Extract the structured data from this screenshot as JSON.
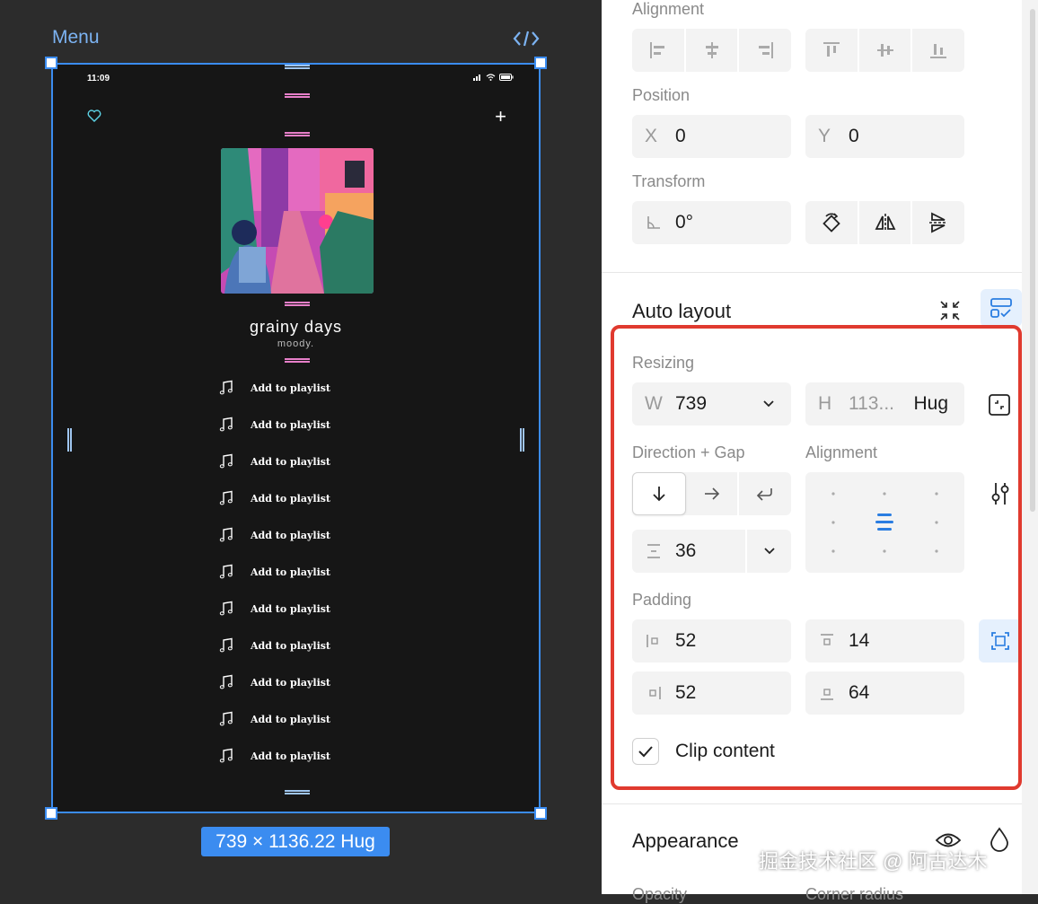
{
  "canvas": {
    "frame_label": "Menu",
    "status_time": "11:09",
    "album": {
      "title": "grainy days",
      "subtitle": "moody."
    },
    "playlist_items": [
      "Add to playlist",
      "Add to playlist",
      "Add to playlist",
      "Add to playlist",
      "Add to playlist",
      "Add to playlist",
      "Add to playlist",
      "Add to playlist",
      "Add to playlist",
      "Add to playlist",
      "Add to playlist"
    ],
    "dimension_badge": "739 × 1136.22 Hug",
    "icons": [
      "code-icon",
      "heart-icon",
      "plus-icon",
      "music-note-icon",
      "signal-icon",
      "wifi-icon",
      "battery-icon"
    ]
  },
  "panel": {
    "alignment_top_label": "Alignment",
    "position_label": "Position",
    "position_x_prefix": "X",
    "position_x": "0",
    "position_y_prefix": "Y",
    "position_y": "0",
    "transform_label": "Transform",
    "rotation": "0°",
    "auto_layout_title": "Auto layout",
    "resizing_label": "Resizing",
    "width_prefix": "W",
    "width_value": "739",
    "height_prefix": "H",
    "height_value": "113...",
    "height_mode": "Hug",
    "direction_gap_label": "Direction + Gap",
    "alignment_label": "Alignment",
    "gap_value": "36",
    "padding_label": "Padding",
    "padding_left": "52",
    "padding_top": "14",
    "padding_right": "52",
    "padding_bottom": "64",
    "clip_content_label": "Clip content",
    "appearance_title": "Appearance",
    "opacity_label": "Opacity",
    "corner_radius_label": "Corner radius"
  },
  "watermark": "掘金技术社区 @ 阿古达木",
  "colors": {
    "selection": "#3b8cf0",
    "highlight": "#e03a2f",
    "spacer": "#e77fc9"
  }
}
